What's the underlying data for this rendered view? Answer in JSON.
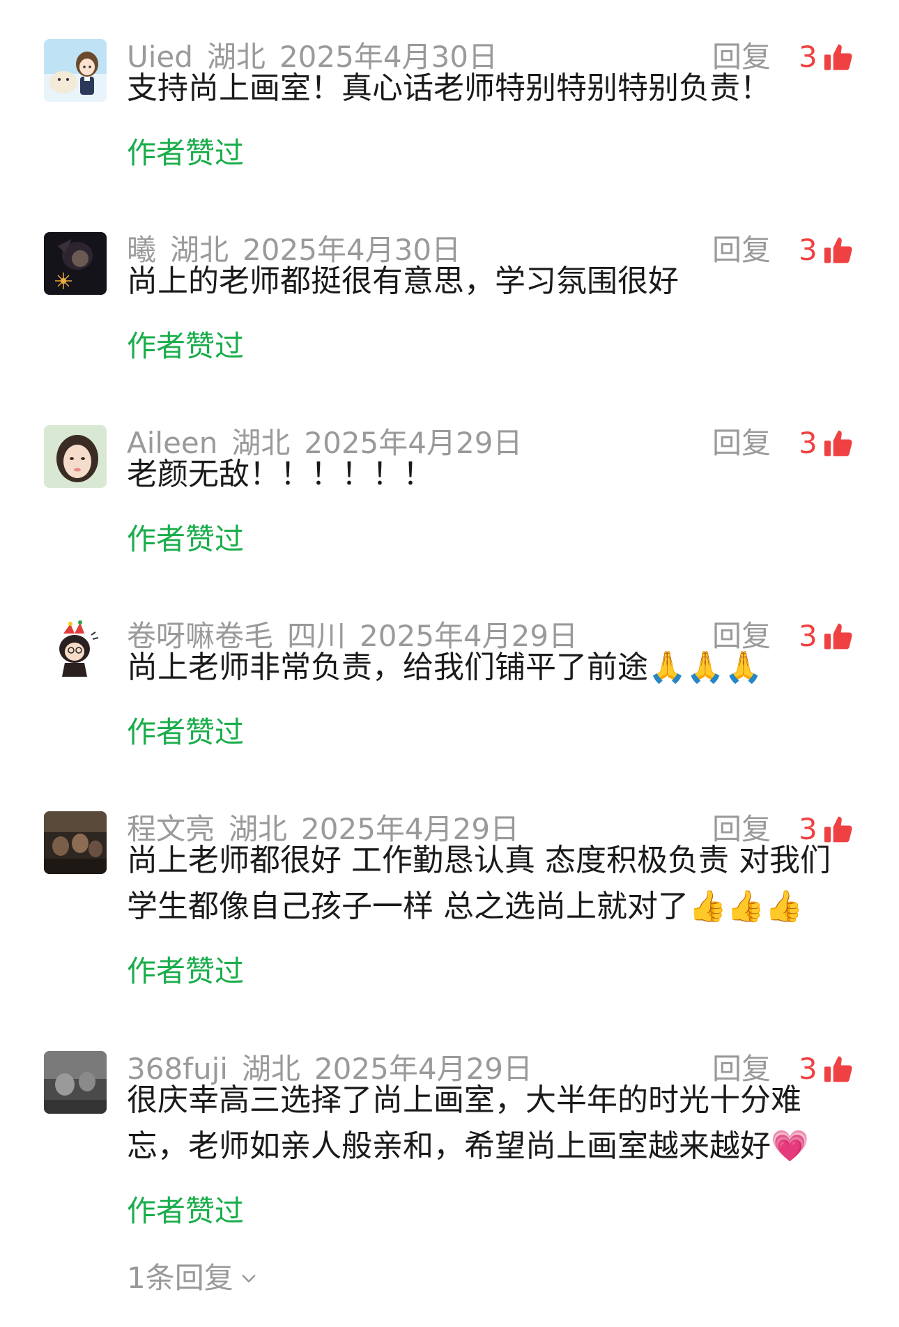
{
  "comments": [
    {
      "username": "Uied",
      "location": "湖北",
      "date": "2025年4月30日",
      "reply_label": "回复",
      "likes": "3",
      "text": "支持尚上画室！真心话老师特别特别特别负责！",
      "author_liked": "作者赞过",
      "avatar": "anime-girl-avatar"
    },
    {
      "username": "曦",
      "location": "湖北",
      "date": "2025年4月30日",
      "reply_label": "回复",
      "likes": "3",
      "text": "尚上的老师都挺很有意思，学习氛围很好",
      "author_liked": "作者赞过",
      "avatar": "dark-portrait-avatar"
    },
    {
      "username": "Aileen",
      "location": "湖北",
      "date": "2025年4月29日",
      "reply_label": "回复",
      "likes": "3",
      "text": "老颜无敌！！！！！！",
      "author_liked": "作者赞过",
      "avatar": "girl-portrait-avatar"
    },
    {
      "username": "卷呀嘛卷毛",
      "location": "四川",
      "date": "2025年4月29日",
      "reply_label": "回复",
      "likes": "3",
      "text": "尚上老师非常负责，给我们铺平了前途🙏🙏🙏",
      "author_liked": "作者赞过",
      "avatar": "cartoon-character-avatar"
    },
    {
      "username": "程文亮",
      "location": "湖北",
      "date": "2025年4月29日",
      "reply_label": "回复",
      "likes": "3",
      "text": "尚上老师都很好 工作勤恳认真 态度积极负责 对我们学生都像自己孩子一样 总之选尚上就对了👍👍👍",
      "author_liked": "作者赞过",
      "avatar": "group-photo-avatar"
    },
    {
      "username": "368fuji",
      "location": "湖北",
      "date": "2025年4月29日",
      "reply_label": "回复",
      "likes": "3",
      "text": "很庆幸高三选择了尚上画室，大半年的时光十分难忘，老师如亲人般亲和，希望尚上画室越来越好💗",
      "author_liked": "作者赞过",
      "avatar": "grey-photo-avatar",
      "replies_toggle": "1条回复"
    }
  ],
  "colors": {
    "meta_gray": "#9a9a9a",
    "like_red": "#f04142",
    "author_liked_green": "#1aad4b",
    "text_dark": "#1a1a1a"
  },
  "icons": {
    "like": "thumbs-up-icon",
    "expand": "chevron-down-icon"
  }
}
